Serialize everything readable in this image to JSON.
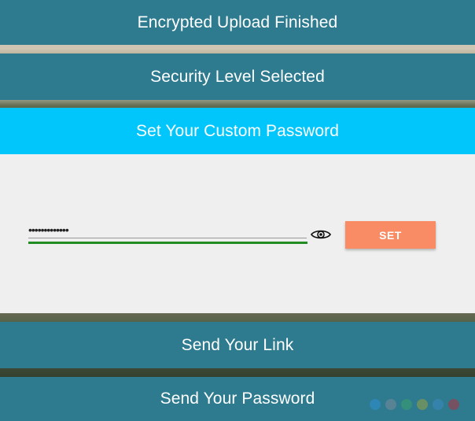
{
  "steps": {
    "upload": {
      "label": "Encrypted Upload Finished",
      "state": "done"
    },
    "security": {
      "label": "Security Level Selected",
      "state": "done"
    },
    "custom_password": {
      "label": "Set Your Custom Password",
      "state": "active"
    },
    "send_link": {
      "label": "Send Your Link",
      "state": "pending"
    },
    "send_password": {
      "label": "Send Your Password",
      "state": "pending"
    }
  },
  "password_form": {
    "value": "•••••••••••••",
    "strength_color": "#218c21",
    "reveal_icon": "eye-icon",
    "set_label": "SET"
  },
  "colors": {
    "bar_done": "#2e7b90",
    "bar_active": "#00c6fb",
    "set_button": "#f98c64",
    "panel": "#efefef"
  },
  "watermark": {
    "dot_colors": [
      "#2e8fd0",
      "#7a8a99",
      "#3aa06a",
      "#9aa040",
      "#3d8ac0",
      "#b0303a"
    ]
  }
}
